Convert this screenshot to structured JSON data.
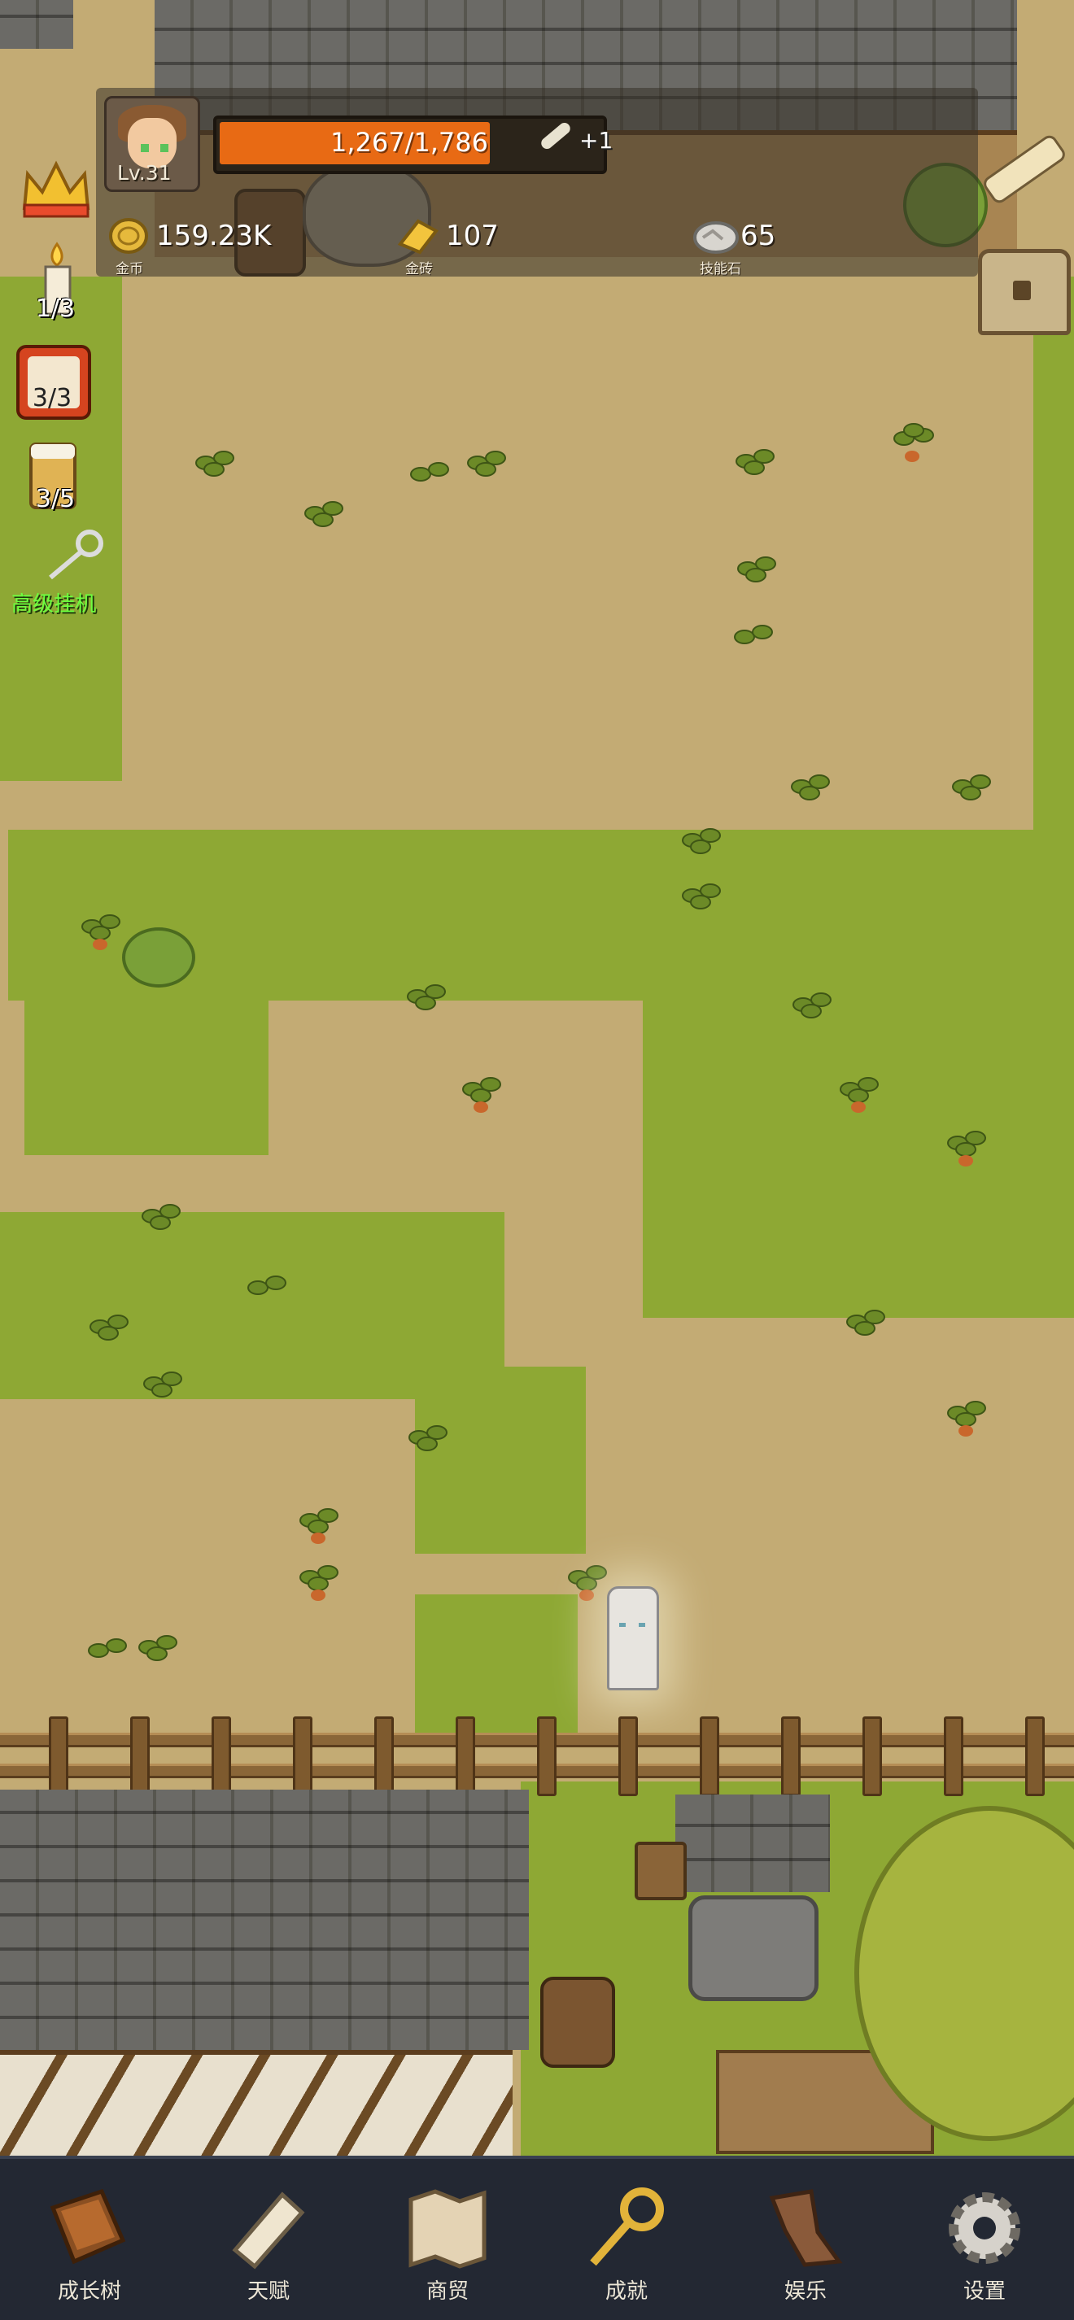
{
  "player": {
    "level": "Lv.31",
    "xp_text": "1,267/1,786",
    "xp_fraction": 0.709,
    "xp_bonus": "+1"
  },
  "currencies": [
    {
      "value": "159.23K",
      "label": "金币",
      "icon": "gold-coin-icon"
    },
    {
      "value": "107",
      "label": "金砖",
      "icon": "gold-brick-icon"
    },
    {
      "value": "65",
      "label": "技能石",
      "icon": "skill-stone-icon"
    }
  ],
  "side": {
    "candle_count": "1/3",
    "dice_count": "3/3",
    "beer_count": "3/5",
    "idle_label": "高级挂机"
  },
  "nav": [
    {
      "label": "成长树",
      "icon": "book-icon"
    },
    {
      "label": "天赋",
      "icon": "scroll-icon"
    },
    {
      "label": "商贸",
      "icon": "map-icon"
    },
    {
      "label": "成就",
      "icon": "key-icon"
    },
    {
      "label": "娱乐",
      "icon": "cloth-icon"
    },
    {
      "label": "设置",
      "icon": "gear-icon"
    }
  ],
  "colors": {
    "xp_fill": "#e86a14",
    "nav_bg": "#232833",
    "idle_label": "#6dff3f"
  }
}
